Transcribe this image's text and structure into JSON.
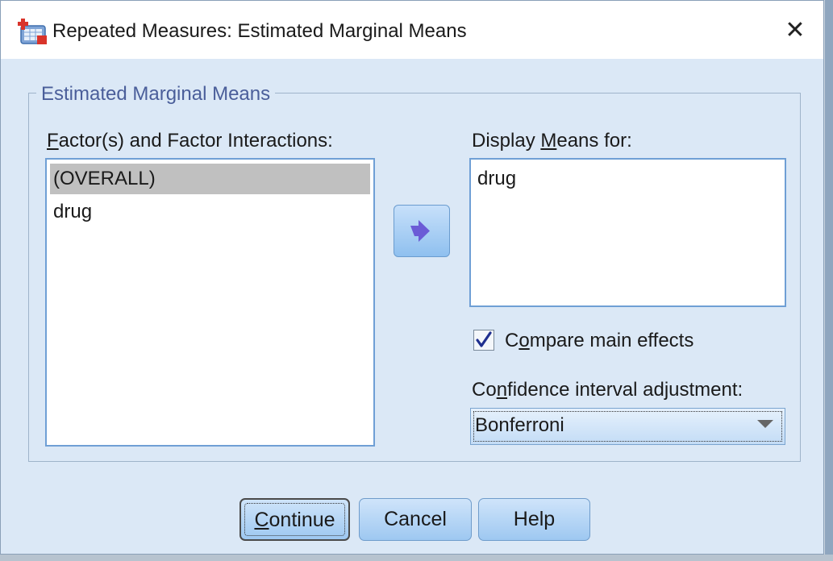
{
  "window": {
    "title": "Repeated Measures: Estimated Marginal Means",
    "close_glyph": "✕"
  },
  "group": {
    "legend": "Estimated Marginal Means"
  },
  "factors": {
    "label_mnemonic": "F",
    "label_rest": "actor(s) and Factor Interactions:",
    "items": [
      "(OVERALL)",
      "drug"
    ],
    "selected_index": 0
  },
  "display_means": {
    "label_pre": "Display ",
    "label_mnemonic": "M",
    "label_rest": "eans for:",
    "items": [
      "drug"
    ]
  },
  "move_button": {
    "icon": "right-arrow-icon",
    "color": "#6b5bd6"
  },
  "compare": {
    "label_pre": "C",
    "label_mnemonic": "o",
    "label_rest": "mpare main effects",
    "checked": true
  },
  "ci": {
    "label_pre": "Co",
    "label_mnemonic": "n",
    "label_rest": "fidence interval adjustment:",
    "selected": "Bonferroni"
  },
  "buttons": {
    "continue_mnemonic": "C",
    "continue_rest": "ontinue",
    "cancel": "Cancel",
    "help": "Help"
  }
}
